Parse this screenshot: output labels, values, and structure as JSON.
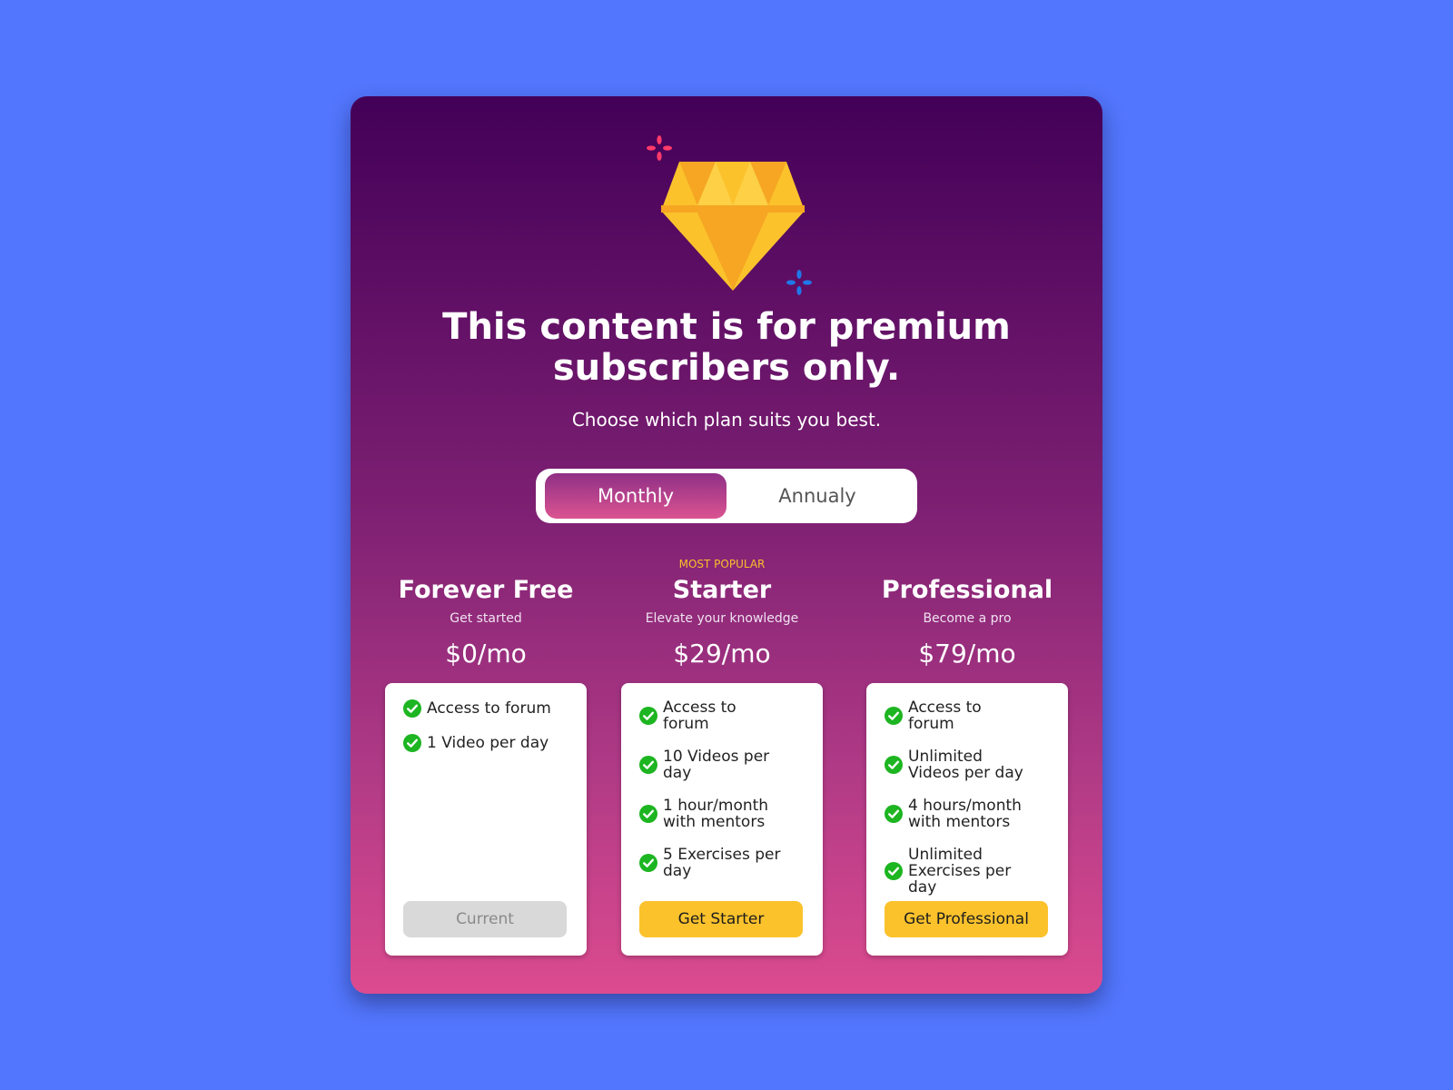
{
  "colors": {
    "page_bg": "#5276fd",
    "gradient_top": "#430058",
    "gradient_bottom": "#dc4b8f",
    "accent_yellow": "#fbc22c",
    "check_green": "#1db521",
    "sparkle_red": "#ff3b6b",
    "sparkle_blue": "#1f78e8"
  },
  "hero": {
    "icon": "diamond-icon",
    "title_line1": "This content is for premium",
    "title_line2": "subscribers only.",
    "subtitle": "Choose which plan suits you best."
  },
  "billing_toggle": {
    "selected": "Monthly",
    "options": [
      "Monthly",
      "Annualy"
    ]
  },
  "plans": [
    {
      "badge": "",
      "name": "Forever Free",
      "tagline": "Get started",
      "price": "$0/mo",
      "features": [
        "Access to forum",
        "1 Video per day"
      ],
      "button": "Current"
    },
    {
      "badge": "MOST POPULAR",
      "name": "Starter",
      "tagline": "Elevate your knowledge",
      "price": "$29/mo",
      "features": [
        "Access to forum",
        "10 Videos per day",
        "1 hour/month with mentors",
        "5 Exercises per day"
      ],
      "button": "Get Starter"
    },
    {
      "badge": "",
      "name": "Professional",
      "tagline": "Become a pro",
      "price": "$79/mo",
      "features": [
        "Access to forum",
        "Unlimited Videos per day",
        "4 hours/month with mentors",
        "Unlimited Exercises per day"
      ],
      "button": "Get Professional"
    }
  ]
}
